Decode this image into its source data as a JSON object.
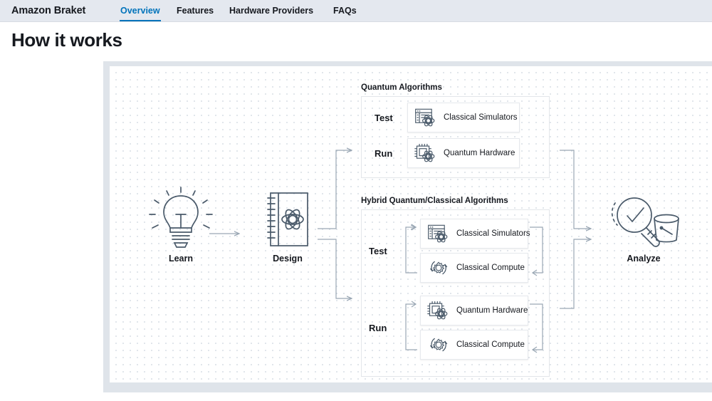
{
  "nav": {
    "brand": "Amazon Braket",
    "tabs": [
      {
        "label": "Overview",
        "active": true
      },
      {
        "label": "Features",
        "active": false
      },
      {
        "label": "Hardware Providers",
        "active": false
      },
      {
        "label": "FAQs",
        "active": false
      }
    ]
  },
  "page": {
    "title": "How it works"
  },
  "diagram": {
    "stages": [
      {
        "label": "Learn",
        "icon": "lightbulb-icon"
      },
      {
        "label": "Design",
        "icon": "notebook-atom-icon"
      },
      {
        "label": "Analyze",
        "icon": "magnifier-check-bucket-icon"
      }
    ],
    "groups": [
      {
        "title": "Quantum Algorithms",
        "rows": [
          {
            "phase": "Test",
            "cards": [
              {
                "label": "Classical Simulators",
                "icon": "browser-atom-icon"
              }
            ]
          },
          {
            "phase": "Run",
            "cards": [
              {
                "label": "Quantum Hardware",
                "icon": "chip-atom-icon"
              }
            ]
          }
        ]
      },
      {
        "title": "Hybrid Quantum/Classical Algorithms",
        "rows": [
          {
            "phase": "Test",
            "cards": [
              {
                "label": "Classical Simulators",
                "icon": "browser-atom-icon"
              },
              {
                "label": "Classical Compute",
                "icon": "gear-refresh-icon"
              }
            ]
          },
          {
            "phase": "Run",
            "cards": [
              {
                "label": "Quantum Hardware",
                "icon": "chip-atom-icon"
              },
              {
                "label": "Classical Compute",
                "icon": "gear-refresh-icon"
              }
            ]
          }
        ]
      }
    ]
  },
  "colors": {
    "accent": "#0073bb",
    "text": "#16191f",
    "nav_bg": "#e4e8ef",
    "frame_bg": "#dfe4ea",
    "line": "#8e9cab",
    "icon_stroke": "#4a5a6a",
    "card_border": "#e6e9ed",
    "dot_grid": "#d7dde4"
  }
}
